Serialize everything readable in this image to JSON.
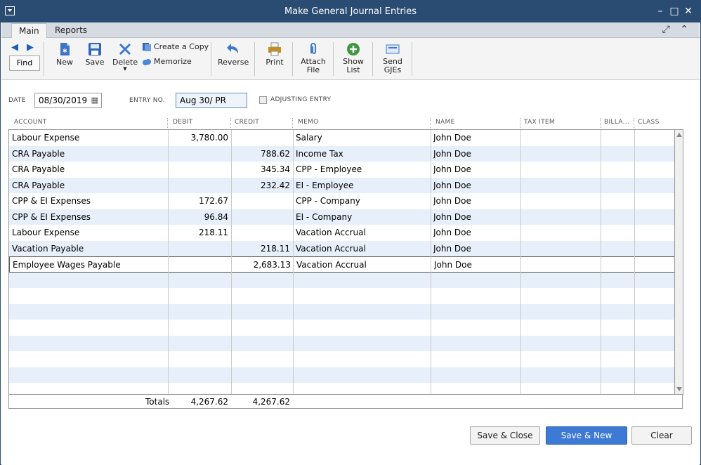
{
  "window": {
    "title": "Make General Journal Entries"
  },
  "tabs": [
    {
      "label": "Main"
    },
    {
      "label": "Reports"
    }
  ],
  "toolbar": {
    "find": "Find",
    "new": "New",
    "save": "Save",
    "delete": "Delete",
    "create_copy": "Create a Copy",
    "memorize": "Memorize",
    "reverse": "Reverse",
    "print": "Print",
    "attach_file_1": "Attach",
    "attach_file_2": "File",
    "show_list_1": "Show",
    "show_list_2": "List",
    "send_gjes_1": "Send",
    "send_gjes_2": "GJEs"
  },
  "form": {
    "date_label": "DATE",
    "date_value": "08/30/2019",
    "entry_no_label": "ENTRY NO.",
    "entry_no_value": "Aug 30/ PR",
    "adjusting_label": "ADJUSTING ENTRY"
  },
  "columns": {
    "account": "ACCOUNT",
    "debit": "DEBIT",
    "credit": "CREDIT",
    "memo": "MEMO",
    "name": "NAME",
    "tax_item": "TAX ITEM",
    "billable": "BILLA...",
    "class": "CLASS"
  },
  "rows": [
    {
      "account": "Labour Expense",
      "debit": "3,780.00",
      "credit": "",
      "memo": "Salary",
      "name": "John Doe"
    },
    {
      "account": "CRA Payable",
      "debit": "",
      "credit": "788.62",
      "memo": "Income Tax",
      "name": "John Doe"
    },
    {
      "account": "CRA Payable",
      "debit": "",
      "credit": "345.34",
      "memo": "CPP - Employee",
      "name": "John Doe"
    },
    {
      "account": "CRA Payable",
      "debit": "",
      "credit": "232.42",
      "memo": "EI - Employee",
      "name": "John Doe"
    },
    {
      "account": "CPP & EI Expenses",
      "debit": "172.67",
      "credit": "",
      "memo": "CPP - Company",
      "name": "John Doe"
    },
    {
      "account": "CPP & EI Expenses",
      "debit": "96.84",
      "credit": "",
      "memo": "EI - Company",
      "name": "John Doe"
    },
    {
      "account": "Labour Expense",
      "debit": "218.11",
      "credit": "",
      "memo": "Vacation Accrual",
      "name": "John Doe"
    },
    {
      "account": "Vacation Payable",
      "debit": "",
      "credit": "218.11",
      "memo": "Vacation Accrual",
      "name": "John Doe"
    },
    {
      "account": "Employee Wages Payable",
      "debit": "",
      "credit": "2,683.13",
      "memo": "Vacation Accrual",
      "name": "John Doe"
    }
  ],
  "totals": {
    "label": "Totals",
    "debit": "4,267.62",
    "credit": "4,267.62"
  },
  "buttons": {
    "save_close": "Save & Close",
    "save_new": "Save & New",
    "clear": "Clear"
  },
  "colors": {
    "titlebar": "#2a4b72",
    "row_alt": "#e6effa",
    "primary": "#3d7ad6"
  }
}
